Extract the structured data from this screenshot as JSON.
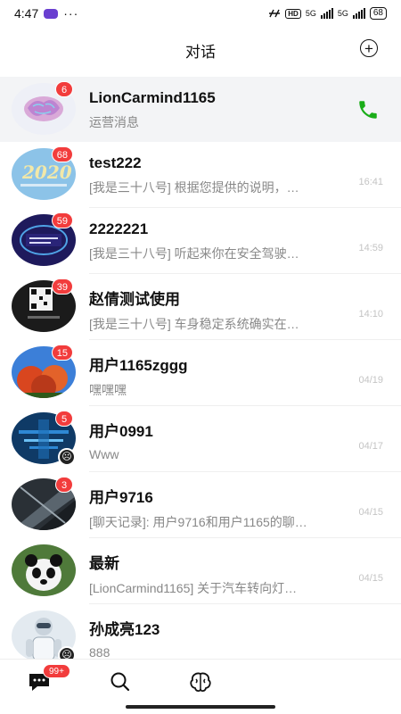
{
  "status_bar": {
    "time": "4:47",
    "more": "···",
    "hd": "HD",
    "net1": "5G",
    "net2": "5G",
    "battery": "68"
  },
  "header": {
    "title": "对话",
    "add_icon": "plus-circle-icon"
  },
  "conversations": [
    {
      "name": "LionCarmind1165",
      "preview": "运营消息",
      "time": "",
      "badge": "6",
      "pinned": true,
      "action_icon": "phone-icon",
      "color": "#1aad19"
    },
    {
      "name": "test222",
      "preview": "[我是三十八号] 根据您提供的说明，…",
      "time": "16:41",
      "badge": "68"
    },
    {
      "name": "2222221",
      "preview": "[我是三十八号] 听起来你在安全驾驶…",
      "time": "14:59",
      "badge": "59"
    },
    {
      "name": "赵倩测试使用",
      "preview": "[我是三十八号] 车身稳定系统确实在…",
      "time": "14:10",
      "badge": "39"
    },
    {
      "name": "用户1165zggg",
      "preview": "嘿嘿嘿",
      "time": "04/19",
      "badge": "15"
    },
    {
      "name": "用户0991",
      "preview": "Www",
      "time": "04/17",
      "badge": "5",
      "muted": true
    },
    {
      "name": "用户9716",
      "preview": "[聊天记录]: 用户9716和用户1165的聊…",
      "time": "04/15",
      "badge": "3"
    },
    {
      "name": "最新",
      "preview": "[LionCarmind1165] 关于汽车转向灯…",
      "time": "04/15",
      "badge": ""
    },
    {
      "name": "孙成亮123",
      "preview": "888",
      "time": "",
      "badge": "",
      "muted": true
    }
  ],
  "bottom_nav": {
    "chat_badge": "99+",
    "items": [
      "chat-icon",
      "search-icon",
      "brain-icon"
    ]
  }
}
